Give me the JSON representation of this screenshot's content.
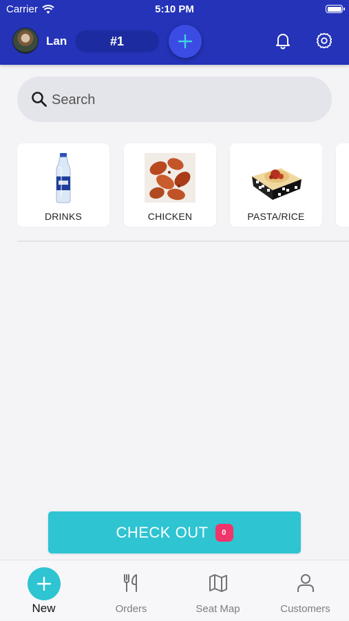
{
  "status_bar": {
    "carrier": "Carrier",
    "time": "5:10 PM"
  },
  "header": {
    "user_name": "Lan",
    "order_number": "#1"
  },
  "search": {
    "placeholder": "Search",
    "value": ""
  },
  "categories": [
    {
      "label": "DRINKS"
    },
    {
      "label": "CHICKEN"
    },
    {
      "label": "PASTA/RICE"
    }
  ],
  "checkout": {
    "label": "CHECK OUT",
    "count": "0"
  },
  "tabs": [
    {
      "label": "New"
    },
    {
      "label": "Orders"
    },
    {
      "label": "Seat Map"
    },
    {
      "label": "Customers"
    }
  ],
  "colors": {
    "header": "#2433b8",
    "accent": "#2ec4d2",
    "badge": "#f0356a"
  }
}
